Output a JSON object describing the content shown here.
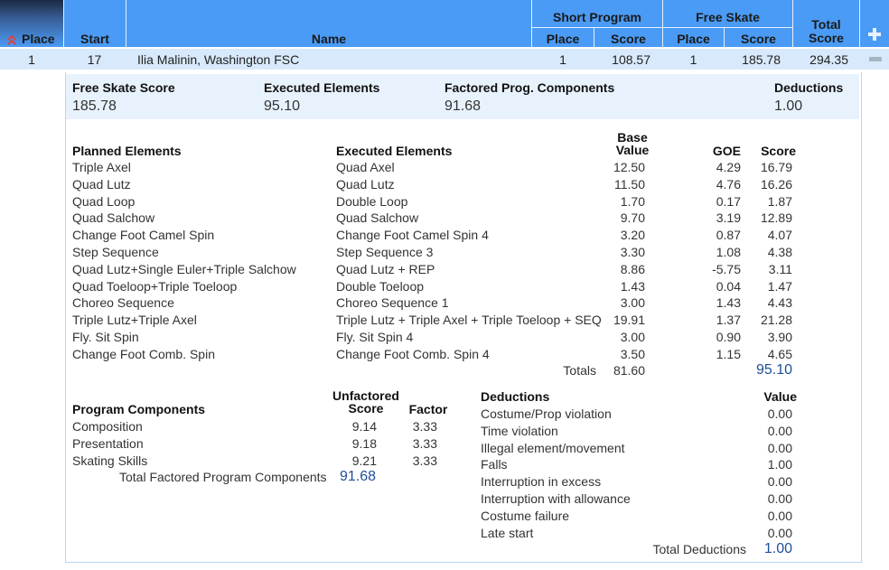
{
  "header": {
    "place": "Place",
    "start": "Start",
    "name": "Name",
    "short_program": "Short Program",
    "sp_place": "Place",
    "sp_score": "Score",
    "free_skate": "Free Skate",
    "fs_place": "Place",
    "fs_score": "Score",
    "total_line1": "Total",
    "total_line2": "Score"
  },
  "athlete": {
    "place": "1",
    "start": "17",
    "name": "Ilia Malinin, Washington FSC",
    "sp_place": "1",
    "sp_score": "108.57",
    "fs_place": "1",
    "fs_score": "185.78",
    "total": "294.35"
  },
  "summary": {
    "fs_score_label": "Free Skate Score",
    "fs_score": "185.78",
    "exec_label": "Executed Elements",
    "exec": "95.10",
    "pc_label": "Factored Prog. Components",
    "pc": "91.68",
    "ded_label": "Deductions",
    "ded": "1.00"
  },
  "elements_header": {
    "planned": "Planned Elements",
    "executed": "Executed Elements",
    "base1": "Base",
    "base2": "Value",
    "goe": "GOE",
    "score": "Score"
  },
  "elements": [
    {
      "planned": "Triple Axel",
      "executed": "Quad Axel",
      "base": "12.50",
      "goe": "4.29",
      "score": "16.79"
    },
    {
      "planned": "Quad Lutz",
      "executed": "Quad Lutz",
      "base": "11.50",
      "goe": "4.76",
      "score": "16.26"
    },
    {
      "planned": "Quad Loop",
      "executed": "Double Loop",
      "base": "1.70",
      "goe": "0.17",
      "score": "1.87"
    },
    {
      "planned": "Quad Salchow",
      "executed": "Quad Salchow",
      "base": "9.70",
      "goe": "3.19",
      "score": "12.89"
    },
    {
      "planned": "Change Foot Camel Spin",
      "executed": "Change Foot Camel Spin 4",
      "base": "3.20",
      "goe": "0.87",
      "score": "4.07"
    },
    {
      "planned": "Step Sequence",
      "executed": "Step Sequence 3",
      "base": "3.30",
      "goe": "1.08",
      "score": "4.38"
    },
    {
      "planned": "Quad Lutz+Single Euler+Triple Salchow",
      "executed": "Quad Lutz + REP",
      "base": "8.86",
      "goe": "-5.75",
      "score": "3.11"
    },
    {
      "planned": "Quad Toeloop+Triple Toeloop",
      "executed": "Double Toeloop",
      "base": "1.43",
      "goe": "0.04",
      "score": "1.47"
    },
    {
      "planned": "Choreo Sequence",
      "executed": "Choreo Sequence 1",
      "base": "3.00",
      "goe": "1.43",
      "score": "4.43"
    },
    {
      "planned": "Triple Lutz+Triple Axel",
      "executed": "Triple Lutz + Triple Axel + Triple Toeloop + SEQ",
      "base": "19.91",
      "goe": "1.37",
      "score": "21.28"
    },
    {
      "planned": "Fly. Sit Spin",
      "executed": "Fly. Sit Spin 4",
      "base": "3.00",
      "goe": "0.90",
      "score": "3.90"
    },
    {
      "planned": "Change Foot Comb. Spin",
      "executed": "Change Foot Comb. Spin 4",
      "base": "3.50",
      "goe": "1.15",
      "score": "4.65"
    }
  ],
  "totals": {
    "label": "Totals",
    "base": "81.60",
    "score": "95.10"
  },
  "components": {
    "title": "Program Components",
    "unf1": "Unfactored",
    "unf2": "Score",
    "factor": "Factor",
    "rows": [
      {
        "name": "Composition",
        "score": "9.14",
        "factor": "3.33"
      },
      {
        "name": "Presentation",
        "score": "9.18",
        "factor": "3.33"
      },
      {
        "name": "Skating Skills",
        "score": "9.21",
        "factor": "3.33"
      }
    ],
    "total_label": "Total Factored Program Components",
    "total": "91.68"
  },
  "deductions": {
    "title": "Deductions",
    "value_header": "Value",
    "rows": [
      {
        "name": "Costume/Prop violation",
        "value": "0.00"
      },
      {
        "name": "Time violation",
        "value": "0.00"
      },
      {
        "name": "Illegal element/movement",
        "value": "0.00"
      },
      {
        "name": "Falls",
        "value": "1.00"
      },
      {
        "name": "Interruption in excess",
        "value": "0.00"
      },
      {
        "name": "Interruption with allowance",
        "value": "0.00"
      },
      {
        "name": "Costume failure",
        "value": "0.00"
      },
      {
        "name": "Late start",
        "value": "0.00"
      }
    ],
    "total_label": "Total Deductions",
    "total": "1.00"
  },
  "colors": {
    "header": "#4a9bf5",
    "row": "#d8e9fb",
    "summary": "#e8f2fd",
    "accent": "#1f4f99"
  },
  "icons": {
    "sort": "sort-up-icon",
    "expand": "plus-icon",
    "collapse": "minus-icon"
  }
}
